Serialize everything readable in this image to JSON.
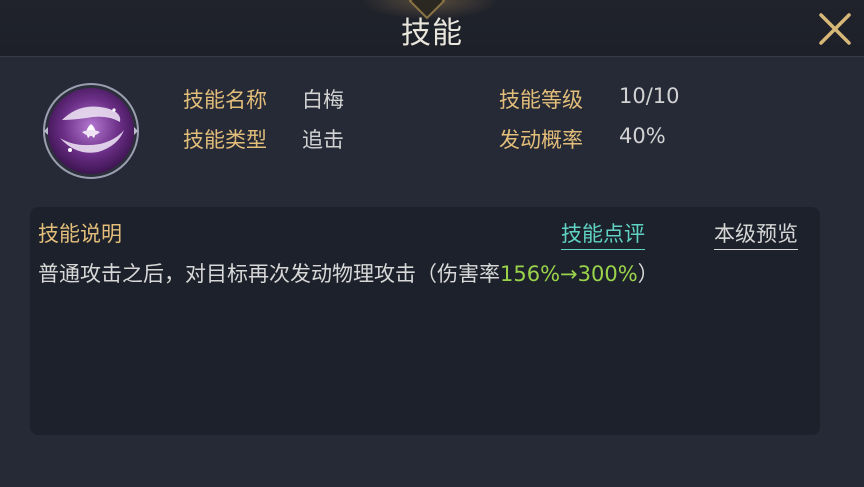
{
  "header": {
    "title": "技能"
  },
  "skill": {
    "icon": "white-plum-skill-icon",
    "fields": {
      "name_label": "技能名称",
      "name_value": "白梅",
      "type_label": "技能类型",
      "type_value": "追击",
      "level_label": "技能等级",
      "level_value": "10/10",
      "chance_label": "发动概率",
      "chance_value": "40%"
    }
  },
  "description": {
    "title": "技能说明",
    "review_link": "技能点评",
    "preview_link": "本级预览",
    "text_before": "普通攻击之后，对目标再次发动物理攻击（伤害率",
    "text_highlight": "156%→300%",
    "text_after": "）"
  },
  "colors": {
    "label_gold": "#e3be7a",
    "highlight_green": "#9ad34b",
    "link_teal": "#5fd3c4",
    "icon_purple": "#6a2e86"
  }
}
